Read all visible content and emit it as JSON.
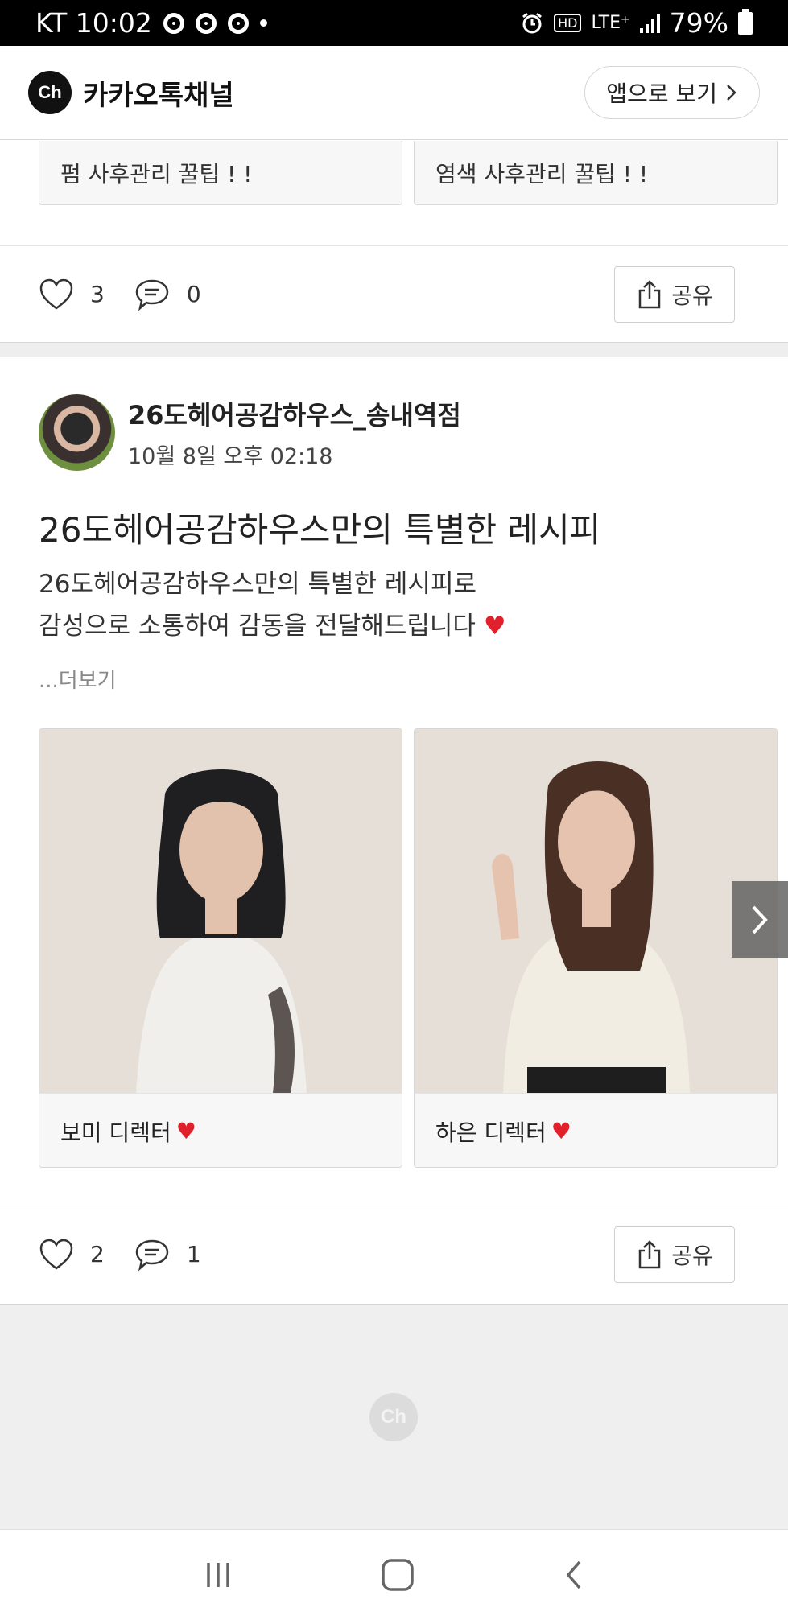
{
  "status_bar": {
    "carrier_time": "KT 10:02",
    "network": "LTE⁺",
    "hd": "HD",
    "battery_percent": "79%"
  },
  "header": {
    "logo_text": "Ch",
    "title": "카카오톡채널",
    "open_app_label": "앱으로 보기"
  },
  "prev_post": {
    "tiles": [
      "펌 사후관리 꿀팁 ! !",
      "염색 사후관리 꿀팁 ! !"
    ],
    "likes": "3",
    "comments": "0",
    "share_label": "공유"
  },
  "post": {
    "author": "26도헤어공감하우스_송내역점",
    "date": "10월 8일 오후 02:18",
    "title": "26도헤어공감하우스만의 특별한 레시피",
    "body_line1": "26도헤어공감하우스만의 특별한 레시피로",
    "body_line2": "감성으로 소통하여 감동을 전달해드립니다",
    "more_label": "...더보기",
    "cards": [
      {
        "caption": "보미 디렉터"
      },
      {
        "caption": "하은 디렉터"
      }
    ],
    "likes": "2",
    "comments": "1",
    "share_label": "공유"
  },
  "footer": {
    "logo_text": "Ch"
  },
  "colors": {
    "heart": "#e0202a",
    "status_bg": "#000000"
  }
}
